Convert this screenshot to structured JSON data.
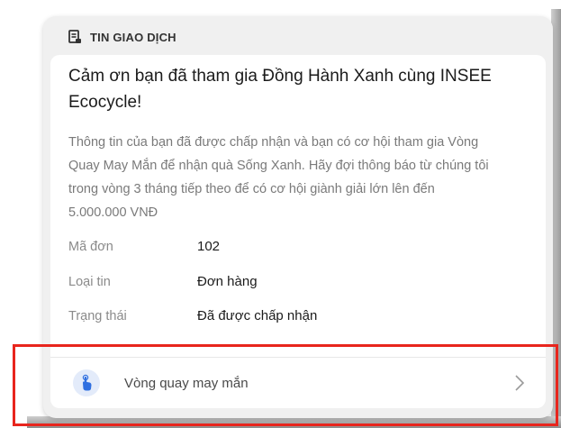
{
  "section": {
    "label": "TIN GIAO DỊCH",
    "icon": "receipt-icon"
  },
  "notification": {
    "title": "Cảm ơn bạn đã tham gia Đồng Hành Xanh cùng INSEE Ecocycle!",
    "description": "Thông tin của bạn đã được chấp nhận và bạn có cơ hội tham gia Vòng Quay May Mắn để nhận quà Sống Xanh. Hãy đợi thông báo từ chúng tôi trong vòng 3 tháng tiếp theo để có cơ hội giành giải lớn lên đến 5.000.000 VNĐ"
  },
  "details": [
    {
      "label": "Mã đơn",
      "value": "102"
    },
    {
      "label": "Loại tin",
      "value": "Đơn hàng"
    },
    {
      "label": "Trạng thái",
      "value": "Đã được chấp nhận"
    }
  ],
  "action": {
    "label": "Vòng quay may mắn",
    "icon": "tap-hand-icon",
    "chevron_icon": "chevron-right-icon"
  },
  "colors": {
    "accent_blue": "#2f6fe0",
    "highlight_red": "#e8251d"
  }
}
